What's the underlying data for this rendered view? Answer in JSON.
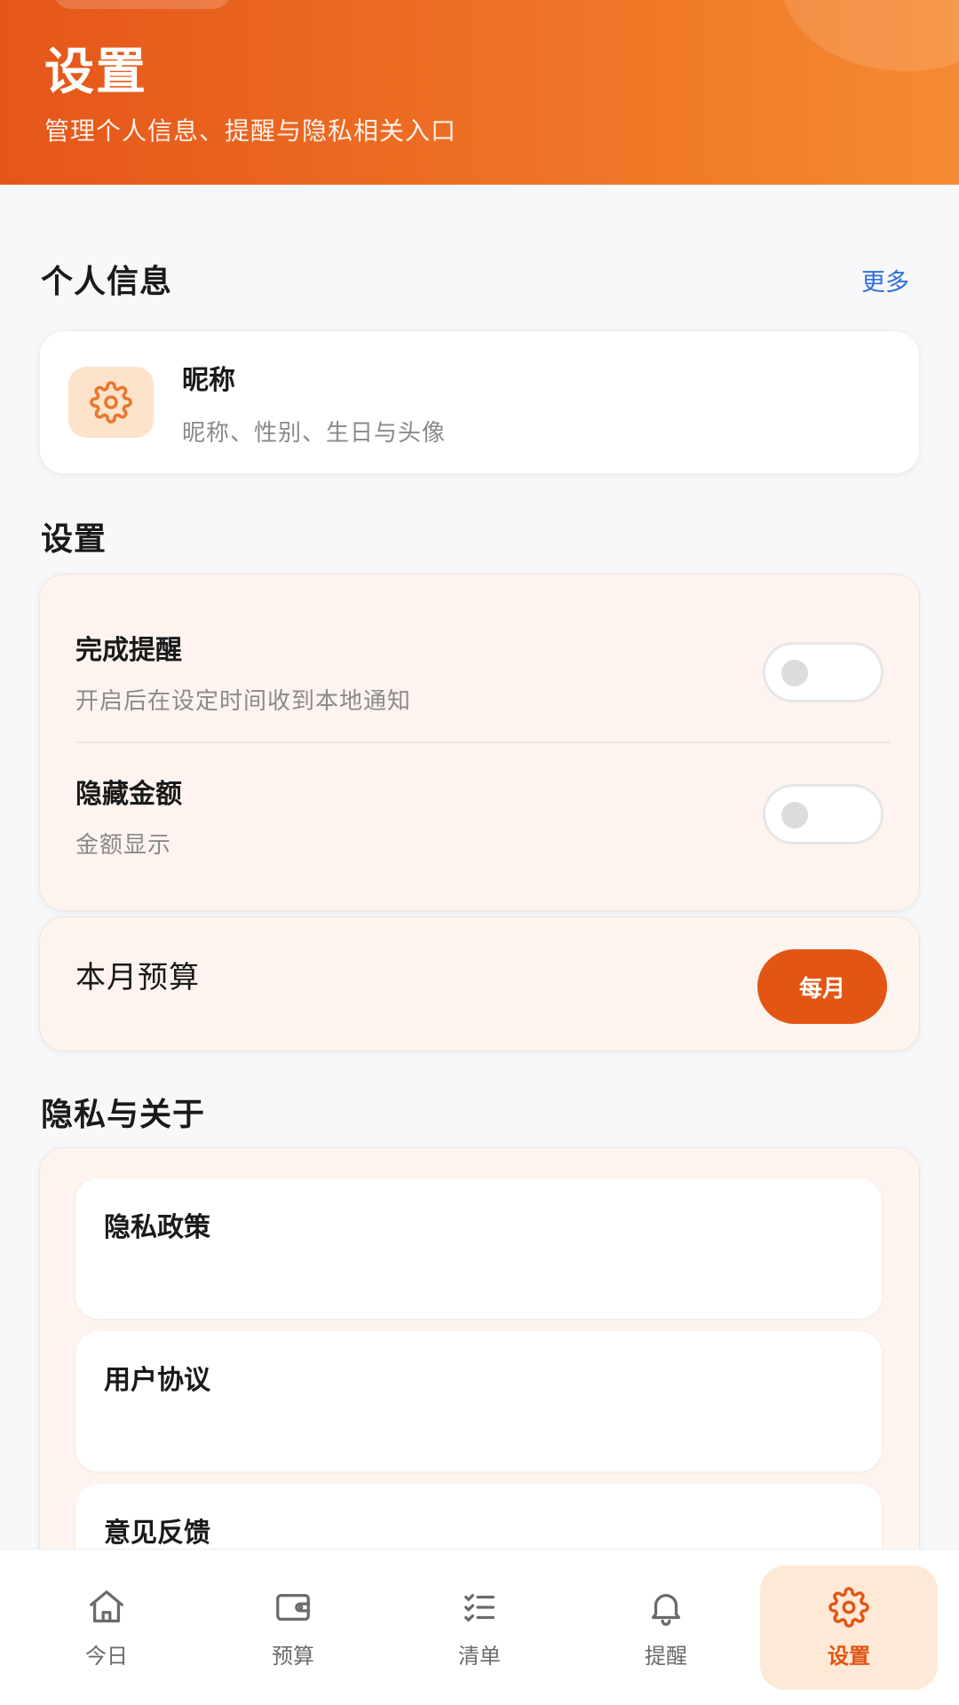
{
  "header": {
    "title": "设置",
    "subtitle": "管理个人信息、提醒与隐私相关入口"
  },
  "personal": {
    "section_title": "个人信息",
    "more_label": "更多",
    "profile": {
      "name": "昵称",
      "desc": "昵称、性别、生日与头像",
      "icon": "gear-icon"
    }
  },
  "settings": {
    "section_title": "设置",
    "rows": [
      {
        "title": "完成提醒",
        "desc": "开启后在设定时间收到本地通知",
        "enabled": false
      },
      {
        "title": "隐藏金额",
        "desc": "金额显示",
        "enabled": false
      }
    ],
    "budget": {
      "label": "本月预算",
      "button": "每月"
    }
  },
  "privacy": {
    "section_title": "隐私与关于",
    "items": [
      {
        "title": "隐私政策"
      },
      {
        "title": "用户协议"
      },
      {
        "title": "意见反馈"
      }
    ]
  },
  "nav": {
    "items": [
      {
        "label": "今日",
        "icon": "home-icon",
        "active": false
      },
      {
        "label": "预算",
        "icon": "wallet-icon",
        "active": false
      },
      {
        "label": "清单",
        "icon": "checklist-icon",
        "active": false
      },
      {
        "label": "提醒",
        "icon": "bell-icon",
        "active": false
      },
      {
        "label": "设置",
        "icon": "gear-icon",
        "active": true
      }
    ]
  },
  "colors": {
    "accent": "#e25512",
    "link": "#2f6fd9",
    "header_start": "#e5561a",
    "header_end": "#f58a35"
  }
}
